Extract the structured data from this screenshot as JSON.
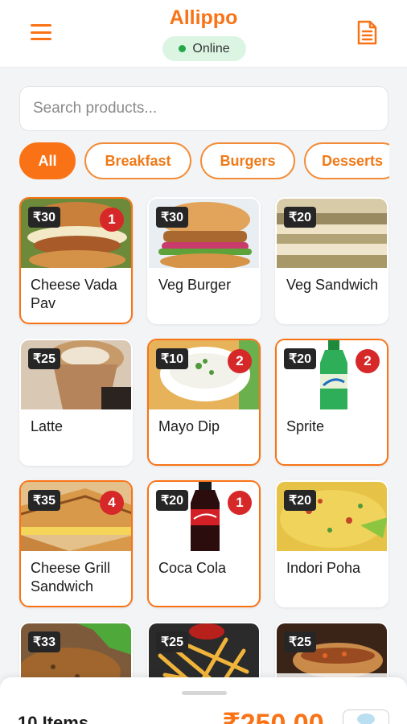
{
  "app": {
    "title": "Allippo",
    "status": "Online",
    "colors": {
      "accent": "#f97316",
      "online": "#22a84a",
      "badge": "#d62828"
    }
  },
  "search": {
    "placeholder": "Search products..."
  },
  "categories": [
    {
      "label": "All",
      "active": true
    },
    {
      "label": "Breakfast",
      "active": false
    },
    {
      "label": "Burgers",
      "active": false
    },
    {
      "label": "Desserts",
      "active": false
    }
  ],
  "products": [
    {
      "name": "Cheese Vada Pav",
      "price": "₹30",
      "qty": "1",
      "image": "vada-pav"
    },
    {
      "name": "Veg Burger",
      "price": "₹30",
      "qty": "",
      "image": "burger"
    },
    {
      "name": "Veg Sandwich",
      "price": "₹20",
      "qty": "",
      "image": "sandwich"
    },
    {
      "name": "Latte",
      "price": "₹25",
      "qty": "",
      "image": "latte"
    },
    {
      "name": "Mayo Dip",
      "price": "₹10",
      "qty": "2",
      "image": "mayo-dip"
    },
    {
      "name": "Sprite",
      "price": "₹20",
      "qty": "2",
      "image": "sprite"
    },
    {
      "name": "Cheese Grill Sandwich",
      "price": "₹35",
      "qty": "4",
      "image": "grill-sandwich"
    },
    {
      "name": "Coca Cola",
      "price": "₹20",
      "qty": "1",
      "image": "coca-cola"
    },
    {
      "name": "Indori Poha",
      "price": "₹20",
      "qty": "",
      "image": "poha"
    },
    {
      "name": "",
      "price": "₹33",
      "qty": "",
      "image": "salad"
    },
    {
      "name": "",
      "price": "₹25",
      "qty": "",
      "image": "fries"
    },
    {
      "name": "",
      "price": "₹25",
      "qty": "",
      "image": "hotdog"
    }
  ],
  "cart": {
    "items_label": "10 Items",
    "total": "₹250.00"
  }
}
